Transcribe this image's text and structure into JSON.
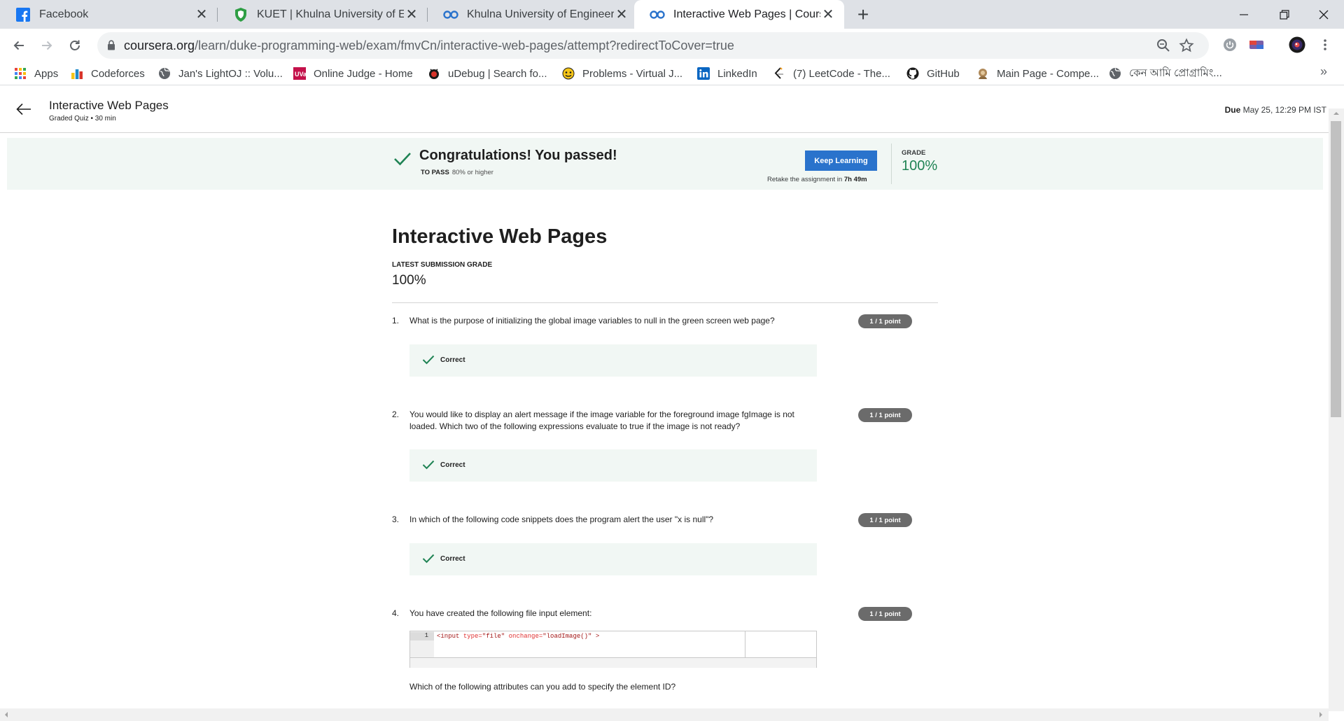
{
  "browser": {
    "tabs": [
      {
        "title": "Facebook",
        "icon": "facebook-icon"
      },
      {
        "title": "KUET | Khulna University of Engin",
        "icon": "kuet-shield-icon"
      },
      {
        "title": "Khulna University of Engineering",
        "icon": "coursera-icon"
      },
      {
        "title": "Interactive Web Pages | Coursera",
        "icon": "coursera-icon",
        "active": true
      }
    ],
    "url_host": "coursera.org",
    "url_path": "/learn/duke-programming-web/exam/fmvCn/interactive-web-pages/attempt?redirectToCover=true",
    "bookmarks": [
      {
        "label": "Apps",
        "icon": "apps-grid-icon"
      },
      {
        "label": "Codeforces",
        "icon": "codeforces-icon"
      },
      {
        "label": "Jan's LightOJ :: Volu...",
        "icon": "globe-icon"
      },
      {
        "label": "Online Judge - Home",
        "icon": "uva-icon"
      },
      {
        "label": "uDebug | Search fo...",
        "icon": "udebug-icon"
      },
      {
        "label": "Problems - Virtual J...",
        "icon": "vjudge-icon"
      },
      {
        "label": "LinkedIn",
        "icon": "linkedin-icon"
      },
      {
        "label": "(7) LeetCode - The...",
        "icon": "leetcode-icon"
      },
      {
        "label": "GitHub",
        "icon": "github-icon"
      },
      {
        "label": "Main Page - Compe...",
        "icon": "wiki-icon"
      },
      {
        "label": "কেন আমি প্রোগ্রামিং...",
        "icon": "globe-icon"
      }
    ],
    "more_bookmarks": "»"
  },
  "header": {
    "title": "Interactive Web Pages",
    "meta": "Graded Quiz • 30 min",
    "due_label": "Due",
    "due_value": "May 25, 12:29 PM IST"
  },
  "banner": {
    "title": "Congratulations! You passed!",
    "to_pass_label": "TO PASS",
    "to_pass_value": "80% or higher",
    "button": "Keep Learning",
    "retake_text": "Retake the assignment in",
    "retake_time": "7h 49m",
    "grade_label": "GRADE",
    "grade_value": "100%"
  },
  "main": {
    "title": "Interactive Web Pages",
    "latest_label": "LATEST SUBMISSION GRADE",
    "latest_value": "100%"
  },
  "questions": [
    {
      "num": "1.",
      "text": "What is the purpose of initializing the global image variables to null in the green screen web page?",
      "points": "1 / 1 point",
      "result": "Correct"
    },
    {
      "num": "2.",
      "text": "You would like to display an alert message if the image variable for the foreground image fgImage is not loaded. Which two of the following expressions evaluate to true if the image is not ready?",
      "points": "1 / 1 point",
      "result": "Correct"
    },
    {
      "num": "3.",
      "text": "In which of the following code snippets does the program alert the user \"x is null\"?",
      "points": "1 / 1 point",
      "result": "Correct"
    },
    {
      "num": "4.",
      "text": "You have created the following file input element:",
      "points": "1 / 1 point",
      "code": {
        "line_number": "1",
        "tag_open": "<input",
        "attr1": "type=",
        "val1": "\"file\"",
        "attr2": "onchange=",
        "val2": "\"loadImage()\"",
        "tag_close": ">"
      },
      "followup": "Which of the following attributes can you add to specify the element ID?"
    }
  ],
  "colors": {
    "accent": "#2a73cc",
    "success": "#1f8354",
    "banner_bg": "#f1f7f4",
    "badge": "#6b6b6b"
  }
}
